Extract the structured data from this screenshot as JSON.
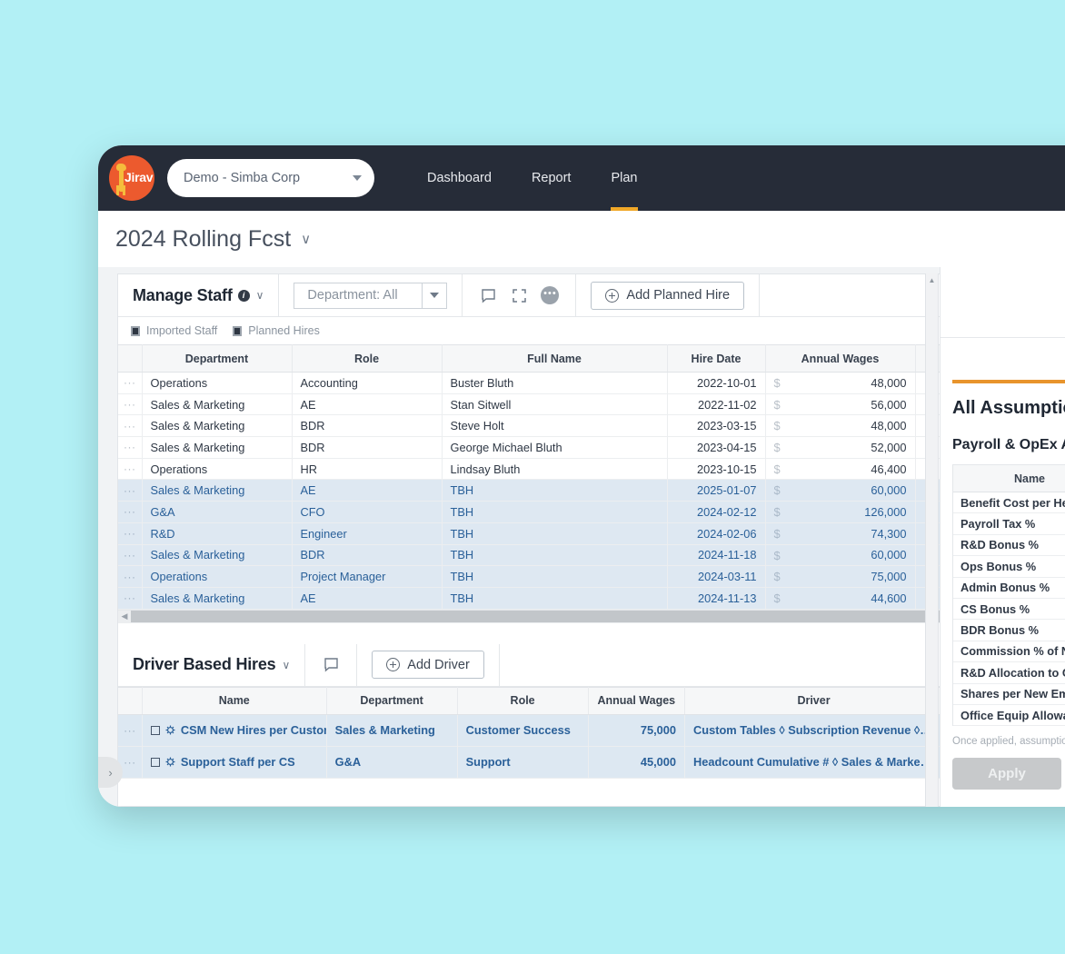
{
  "theme": {
    "page_bg": "#b2f0f5",
    "nav_bg": "#262c38",
    "accent_orange": "#f0a828",
    "planned_row_bg": "#dee8f2",
    "planned_text": "#2a6099",
    "logo_bg": "#ec5a2e"
  },
  "topnav": {
    "logo_text": "Jirav",
    "company_selector": {
      "label": "Demo - Simba Corp"
    },
    "tabs": [
      {
        "label": "Dashboard",
        "active": false
      },
      {
        "label": "Report",
        "active": false
      },
      {
        "label": "Plan",
        "active": true
      }
    ]
  },
  "page_header": {
    "title": "2024 Rolling Fcst",
    "caret": "∨"
  },
  "manage_staff": {
    "title": "Manage Staff",
    "info_badge": "i",
    "title_caret": "∨",
    "department_filter": {
      "value": "Department: All",
      "placeholder": "Department: All"
    },
    "icons": [
      {
        "name": "comment-icon"
      },
      {
        "name": "expand-icon"
      },
      {
        "name": "more-options-icon"
      }
    ],
    "add_button": "Add Planned Hire",
    "legend": [
      {
        "label": "Imported Staff"
      },
      {
        "label": "Planned Hires"
      }
    ],
    "columns": [
      "Department",
      "Role",
      "Full Name",
      "Hire Date",
      "Annual Wages"
    ],
    "currency_symbol": "$",
    "rows": [
      {
        "department": "Operations",
        "role": "Accounting",
        "full_name": "Buster Bluth",
        "hire_date": "2022-10-01",
        "annual_wages": "48,000",
        "planned": false
      },
      {
        "department": "Sales & Marketing",
        "role": "AE",
        "full_name": "Stan Sitwell",
        "hire_date": "2022-11-02",
        "annual_wages": "56,000",
        "planned": false
      },
      {
        "department": "Sales & Marketing",
        "role": "BDR",
        "full_name": "Steve Holt",
        "hire_date": "2023-03-15",
        "annual_wages": "48,000",
        "planned": false
      },
      {
        "department": "Sales & Marketing",
        "role": "BDR",
        "full_name": "George Michael Bluth",
        "hire_date": "2023-04-15",
        "annual_wages": "52,000",
        "planned": false
      },
      {
        "department": "Operations",
        "role": "HR",
        "full_name": "Lindsay Bluth",
        "hire_date": "2023-10-15",
        "annual_wages": "46,400",
        "planned": false
      },
      {
        "department": "Sales & Marketing",
        "role": "AE",
        "full_name": "TBH",
        "hire_date": "2025-01-07",
        "annual_wages": "60,000",
        "planned": true
      },
      {
        "department": "G&A",
        "role": "CFO",
        "full_name": "TBH",
        "hire_date": "2024-02-12",
        "annual_wages": "126,000",
        "planned": true
      },
      {
        "department": "R&D",
        "role": "Engineer",
        "full_name": "TBH",
        "hire_date": "2024-02-06",
        "annual_wages": "74,300",
        "planned": true
      },
      {
        "department": "Sales & Marketing",
        "role": "BDR",
        "full_name": "TBH",
        "hire_date": "2024-11-18",
        "annual_wages": "60,000",
        "planned": true
      },
      {
        "department": "Operations",
        "role": "Project Manager",
        "full_name": "TBH",
        "hire_date": "2024-03-11",
        "annual_wages": "75,000",
        "planned": true
      },
      {
        "department": "Sales & Marketing",
        "role": "AE",
        "full_name": "TBH",
        "hire_date": "2024-11-13",
        "annual_wages": "44,600",
        "planned": true
      }
    ]
  },
  "driver_based_hires": {
    "title": "Driver Based Hires",
    "title_caret": "∨",
    "icons": [
      {
        "name": "comment-icon"
      }
    ],
    "add_button": "Add Driver",
    "columns": [
      "Name",
      "Department",
      "Role",
      "Annual Wages",
      "Driver"
    ],
    "rows": [
      {
        "name": "CSM New Hires per Customers",
        "department": "Sales & Marketing",
        "role": "Customer Success",
        "annual_wages": "75,000",
        "driver": "Custom Tables ◊ Subscription Revenue ◊ Endin"
      },
      {
        "name": "Support Staff per CS",
        "department": "G&A",
        "role": "Support",
        "annual_wages": "45,000",
        "driver": "Headcount Cumulative # ◊ Sales & Marketing ◊"
      }
    ]
  },
  "assumptions_panel": {
    "title": "All Assumptions",
    "subtitle": "Payroll & OpEx Assumptions",
    "column_header": "Name",
    "rows": [
      "Benefit Cost per Head",
      "Payroll Tax %",
      "R&D Bonus %",
      "Ops Bonus %",
      "Admin Bonus %",
      "CS Bonus %",
      "BDR Bonus %",
      "Commission % of New Bookings",
      "R&D Allocation to COGS %",
      "Shares per New Employee",
      "Office Equip Allowance"
    ],
    "note": "Once applied, assumptions update the plan.",
    "apply_button": "Apply"
  },
  "drawer": {
    "handle_glyph": "›"
  }
}
